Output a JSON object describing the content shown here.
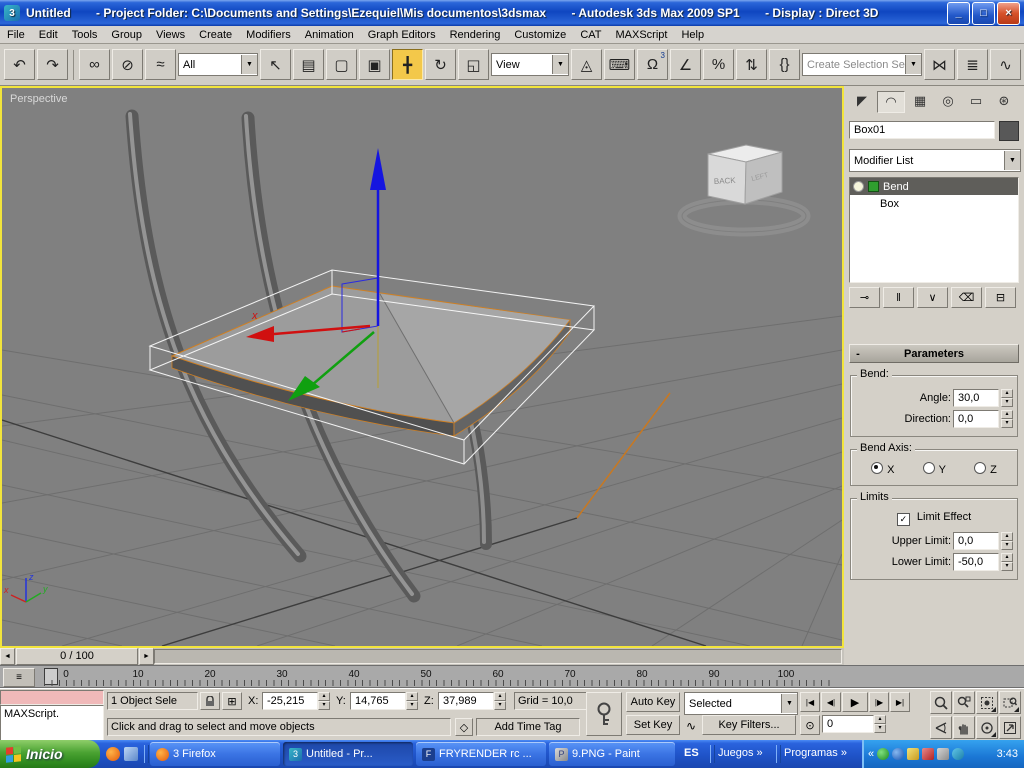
{
  "window": {
    "icon_text": "3",
    "title1": "Untitled",
    "title2": "- Project Folder: C:\\Documents and Settings\\Ezequiel\\Mis documentos\\3dsmax",
    "title3": "- Autodesk 3ds Max  2009 SP1",
    "title4": "- Display : Direct 3D",
    "minimize": "_",
    "maximize": "□",
    "close": "×"
  },
  "menu": {
    "items": [
      "File",
      "Edit",
      "Tools",
      "Group",
      "Views",
      "Create",
      "Modifiers",
      "Animation",
      "Graph Editors",
      "Rendering",
      "Customize",
      "CAT",
      "MAXScript",
      "Help"
    ]
  },
  "toolbar": {
    "filter_value": "All",
    "view_value": "View",
    "selection_set_placeholder": "Create Selection Set",
    "snap_superscript": "3",
    "dropdown_arrow": "▼"
  },
  "icons": {
    "undo": "↶",
    "redo": "↷",
    "link": "∞",
    "unlink": "⊘",
    "bind": "≈",
    "select": "↖",
    "select_by_name": "▤",
    "marquee": "▢",
    "window_crossing": "▣",
    "move": "╋",
    "rotate": "↻",
    "scale": "◱",
    "manipulate": "◬",
    "keyboard": "⌨",
    "snap": "Ω",
    "angle_snap": "∠",
    "percent_snap": "%",
    "spinner_snap": "⇅",
    "named_sel": "{}",
    "mirror": "⋈",
    "align": "≣",
    "curve_editor": "∿",
    "schematic": "⊞",
    "tab_create": "◤",
    "tab_modify": "◠",
    "tab_hierarchy": "▦",
    "tab_motion": "◎",
    "tab_display": "▭",
    "tab_utilities": "⊛",
    "pin_stack": "⊸",
    "show_end_result": "‖",
    "make_unique": "∨",
    "remove_modifier": "⌫",
    "configure": "⊟",
    "spin_up": "▴",
    "spin_down": "▾",
    "trackbar": "≡",
    "time_tag": "◇",
    "key_mode": "⊙",
    "curve_small": "∿"
  },
  "viewport": {
    "label": "Perspective",
    "cube_back": "BACK",
    "cube_left": "LEFT",
    "gizmo_x": "x",
    "axis_x": "x",
    "axis_y": "y",
    "axis_z": "z"
  },
  "command_panel": {
    "object_name": "Box01",
    "modifier_list": "Modifier List",
    "stack_item_1": "Bend",
    "stack_item_2": "Box",
    "rollout_minus": "-",
    "rollout_title": "Parameters",
    "bend_label": "Bend:",
    "angle_label": "Angle:",
    "angle_value": "30,0",
    "direction_label": "Direction:",
    "direction_value": "0,0",
    "axis_label": "Bend Axis:",
    "axis_x": "X",
    "axis_y": "Y",
    "axis_z": "Z",
    "limits_label": "Limits",
    "limit_effect": "Limit Effect",
    "check": "✓",
    "upper_label": "Upper Limit:",
    "upper_value": "0,0",
    "lower_label": "Lower Limit:",
    "lower_value": "-50,0"
  },
  "time_slider": {
    "value": "0 / 100",
    "arrow_left": "◄",
    "arrow_right": "►"
  },
  "timeline": {
    "ticks": [
      "0",
      "10",
      "20",
      "30",
      "40",
      "50",
      "60",
      "70",
      "80",
      "90",
      "100"
    ]
  },
  "status": {
    "listener_text": "MAXScript.",
    "selection": "1 Object Sele",
    "x_label": "X:",
    "x_value": "-25,215",
    "y_label": "Y:",
    "y_value": "14,765",
    "z_label": "Z:",
    "z_value": "37,989",
    "grid": "Grid = 10,0",
    "prompt": "Click and drag to select and move objects",
    "add_time_tag": "Add Time Tag",
    "auto_key": "Auto Key",
    "set_key": "Set Key",
    "selected": "Selected",
    "key_filters": "Key Filters...",
    "frame": "0",
    "play_start": "|◀",
    "play_prev": "◀|",
    "play": "▶",
    "play_next": "|▶",
    "play_end": "▶|"
  },
  "taskbar": {
    "start": "Inicio",
    "tasks": [
      "3 Firefox",
      "Untitled - Pr...",
      "FRYRENDER rc ...",
      "9.PNG - Paint"
    ],
    "task_icons": [
      "F",
      "3",
      "F",
      "P"
    ],
    "lang": "ES",
    "toolbar1": "Juegos",
    "toolbar2": "Programas",
    "chev": "»",
    "collapse": "«",
    "clock": "3:43"
  },
  "colors": {
    "accent_yellow_border": "#f2e43b",
    "taskbar_blue": "#1f53c8",
    "start_green": "#4aa232",
    "gizmo_red": "#d01010",
    "gizmo_green": "#10a010",
    "gizmo_blue": "#1515e0",
    "selection_orange": "#cf7f22",
    "viewport_gray": "#808080"
  }
}
